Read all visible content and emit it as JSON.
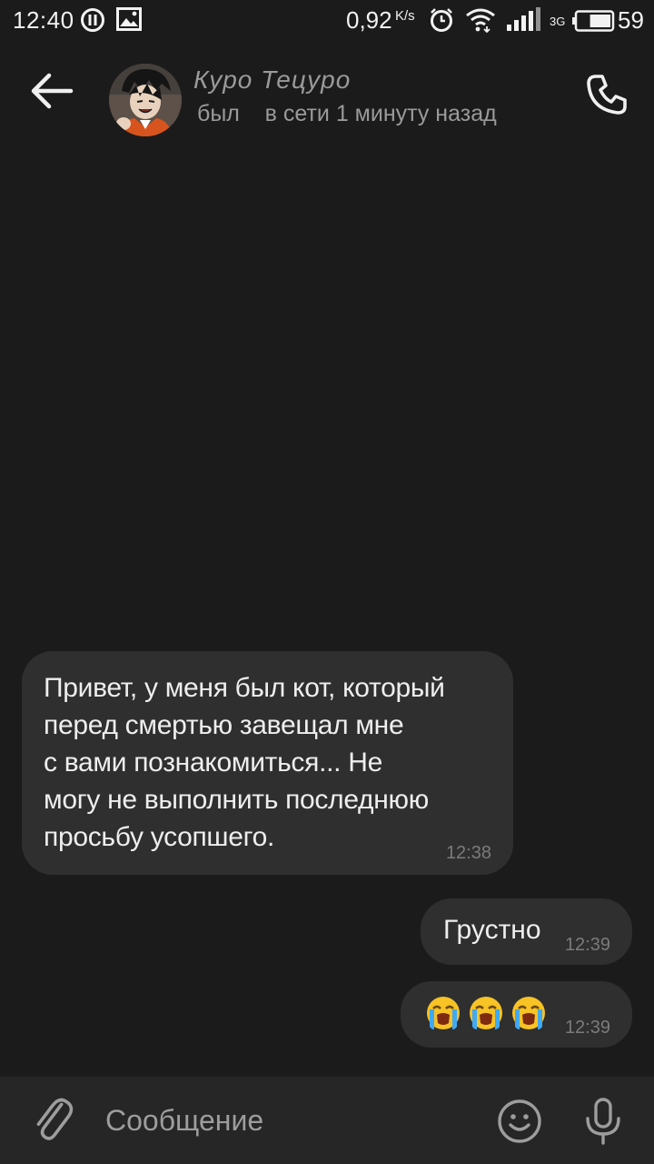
{
  "status_bar": {
    "time": "12:40",
    "speed_value": "0,92",
    "speed_unit": "K/s",
    "network_type": "3G",
    "battery_percent": "59",
    "battery_level": 0.59
  },
  "header": {
    "contact_name": "Куро Тецуро",
    "contact_status": "был    в сети 1 минуту назад",
    "back_icon": "arrow-left-icon",
    "call_icon": "phone-icon"
  },
  "messages": [
    {
      "direction": "incoming",
      "text": "Привет, у меня был кот, который\nперед смертью завещал мне\nс вами познакомиться... Не\nмогу не выполнить последнюю\nпросьбу усопшего.",
      "time": "12:38"
    },
    {
      "direction": "outgoing",
      "text": "Грустно",
      "time": "12:39"
    },
    {
      "direction": "outgoing",
      "emoji": [
        "😭",
        "😭",
        "😭"
      ],
      "emoji_name": "loudly-crying-face",
      "time": "12:39"
    }
  ],
  "composer": {
    "placeholder": "Сообщение",
    "attach_icon": "paperclip-icon",
    "emoji_icon": "smile-icon",
    "mic_icon": "microphone-icon"
  },
  "colors": {
    "background": "#1b1b1b",
    "bubble": "#2f2f2f",
    "composer": "#262626",
    "muted_text": "#9a9a9a",
    "emoji_yellow": "#f7c325",
    "emoji_tear": "#3fa9f5"
  }
}
